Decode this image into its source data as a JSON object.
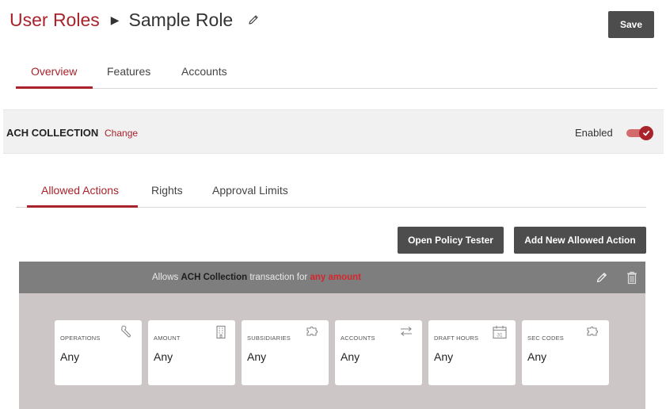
{
  "breadcrumb": {
    "parent": "User Roles",
    "current": "Sample Role"
  },
  "save_label": "Save",
  "top_tabs": [
    {
      "label": "Overview",
      "active": true
    },
    {
      "label": "Features",
      "active": false
    },
    {
      "label": "Accounts",
      "active": false
    }
  ],
  "section": {
    "title": "ACH COLLECTION",
    "change_label": "Change",
    "enabled_label": "Enabled",
    "enabled": true
  },
  "sub_tabs": [
    {
      "label": "Allowed Actions",
      "active": true
    },
    {
      "label": "Rights",
      "active": false
    },
    {
      "label": "Approval Limits",
      "active": false
    }
  ],
  "buttons": {
    "policy_tester": "Open Policy Tester",
    "add_action": "Add New Allowed Action"
  },
  "policy": {
    "prefix": "Allows",
    "transaction": "ACH Collection",
    "middle": "transaction for",
    "amount": "any amount"
  },
  "cards": [
    {
      "label": "OPERATIONS",
      "value": "Any",
      "icon": "wrench-icon"
    },
    {
      "label": "AMOUNT",
      "value": "Any",
      "icon": "building-icon"
    },
    {
      "label": "SUBSIDIARIES",
      "value": "Any",
      "icon": "puzzle-icon"
    },
    {
      "label": "ACCOUNTS",
      "value": "Any",
      "icon": "transfer-arrows-icon"
    },
    {
      "label": "DRAFT HOURS",
      "value": "Any",
      "icon": "calendar-icon",
      "icon_text": "31"
    },
    {
      "label": "SEC CODES",
      "value": "Any",
      "icon": "puzzle-icon"
    }
  ],
  "colors": {
    "accent": "#a8232b",
    "button": "#4d4d4d",
    "panel_header": "#7e7e7e",
    "panel_body": "#ccc6c6",
    "amount": "#d6262d"
  }
}
